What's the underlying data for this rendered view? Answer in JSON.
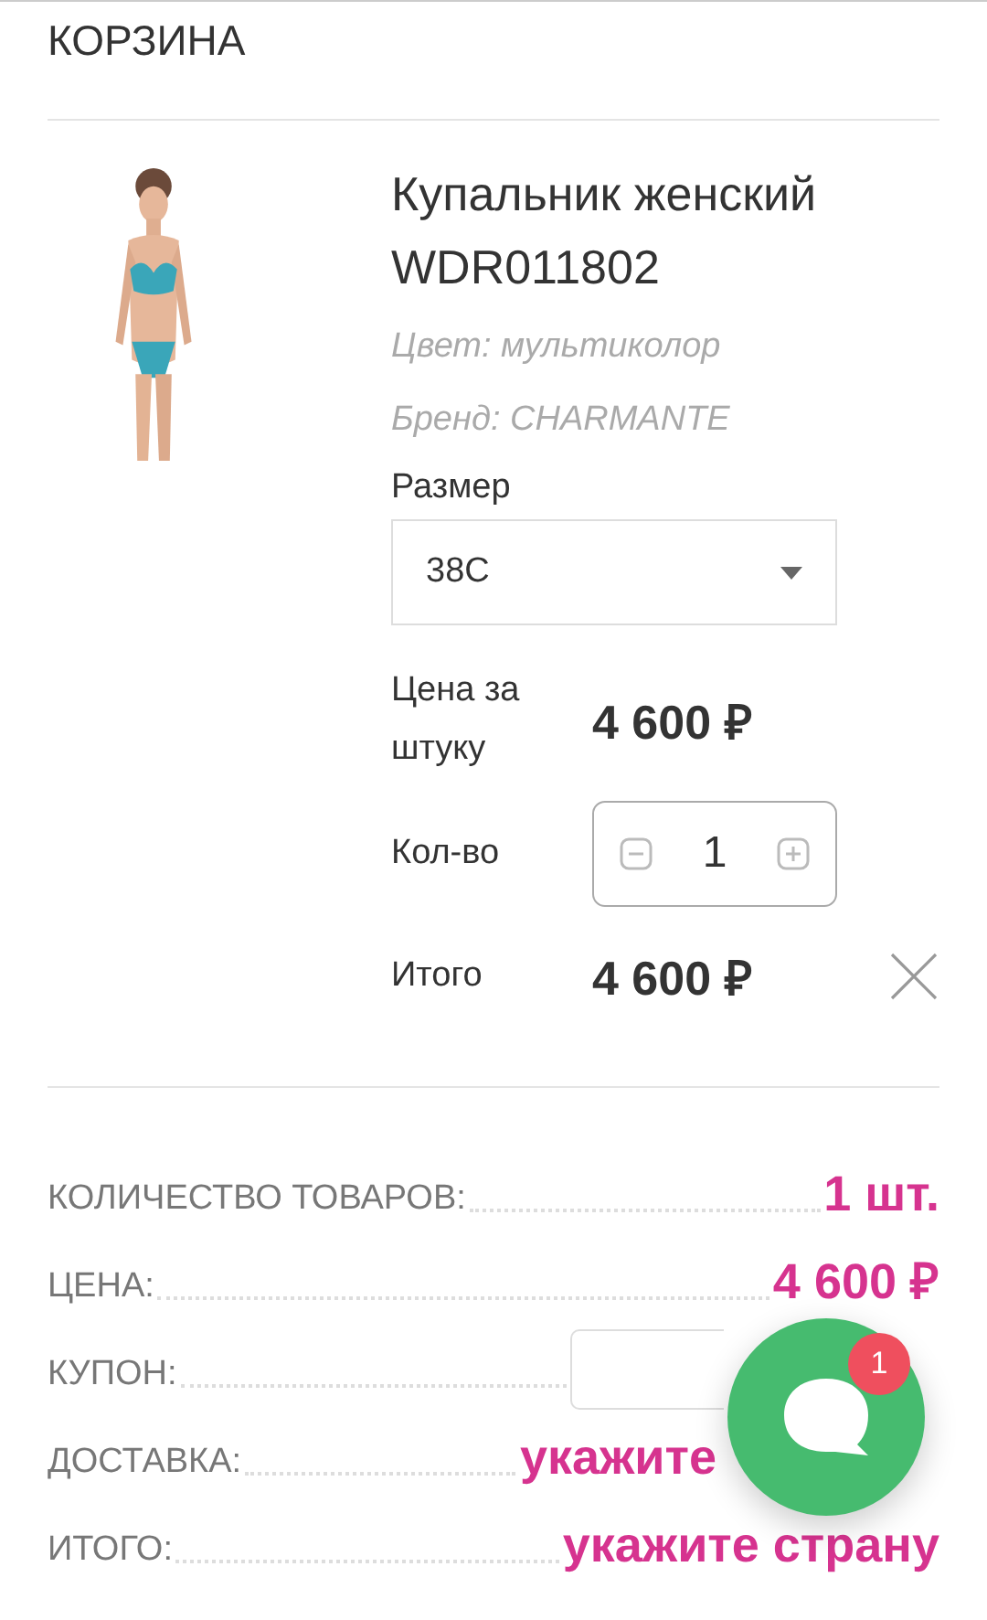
{
  "header": {
    "title": "КОРЗИНА"
  },
  "product": {
    "name": "Купальник женский WDR011802",
    "variant": "Цвет: мультиколор",
    "brand": "Бренд: CHARMANTE",
    "size": {
      "label": "Размер",
      "value": "38C"
    },
    "unit_price": {
      "label": "Цена за штуку",
      "value": "4 600 ₽"
    },
    "quantity": {
      "label": "Кол-во",
      "value": "1"
    },
    "total": {
      "label": "Итого",
      "value": "4 600 ₽"
    }
  },
  "summary": [
    {
      "kind": "value",
      "label": "КОЛИЧЕСТВО ТОВАРОВ:",
      "value": "1 шт."
    },
    {
      "kind": "value",
      "label": "ЦЕНА:",
      "value": "4 600 ₽"
    },
    {
      "kind": "input",
      "label": "КУПОН:"
    },
    {
      "kind": "covered",
      "label": "ДОСТАВКА:",
      "value": "укажите"
    },
    {
      "kind": "value",
      "label": "ИТОГО:",
      "value": "укажите страну"
    }
  ],
  "chat": {
    "badge": "1"
  }
}
